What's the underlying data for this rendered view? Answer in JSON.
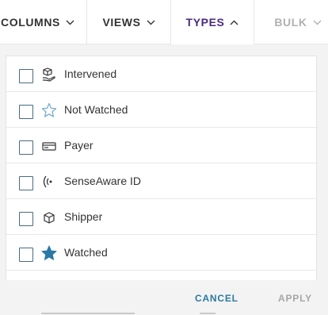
{
  "toolbar": {
    "columns_label": "COLUMNS",
    "views_label": "VIEWS",
    "types_label": "TYPES",
    "bulk_label": "BULK"
  },
  "types_menu": {
    "options": [
      {
        "label": "Intervened",
        "icon": "intervened-icon",
        "checked": false
      },
      {
        "label": "Not Watched",
        "icon": "star-outline-icon",
        "checked": false
      },
      {
        "label": "Payer",
        "icon": "payer-card-icon",
        "checked": false
      },
      {
        "label": "SenseAware ID",
        "icon": "sensor-signal-icon",
        "checked": false
      },
      {
        "label": "Shipper",
        "icon": "package-box-icon",
        "checked": false
      },
      {
        "label": "Watched",
        "icon": "star-filled-icon",
        "checked": false
      }
    ],
    "cancel_label": "CANCEL",
    "apply_label": "APPLY"
  },
  "colors": {
    "active_tab": "#4b2a82",
    "cancel_link": "#2c7aa1",
    "apply_disabled": "#a6a6a6",
    "watched_star": "#2a78a6",
    "outline_star": "#6fa6c8"
  }
}
